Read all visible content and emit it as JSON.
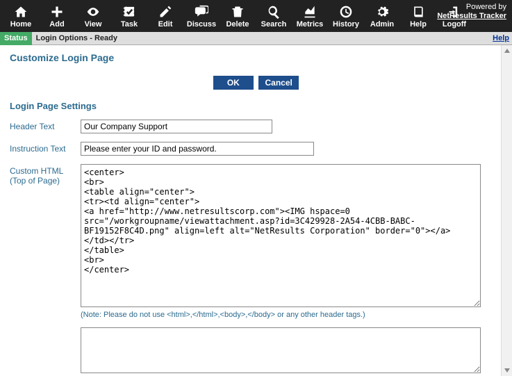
{
  "toolbar": {
    "items": [
      {
        "label": "Home",
        "icon": "home"
      },
      {
        "label": "Add",
        "icon": "plus"
      },
      {
        "label": "View",
        "icon": "eye"
      },
      {
        "label": "Task",
        "icon": "check"
      },
      {
        "label": "Edit",
        "icon": "pencil"
      },
      {
        "label": "Discuss",
        "icon": "chat"
      },
      {
        "label": "Delete",
        "icon": "trash"
      },
      {
        "label": "Search",
        "icon": "search"
      },
      {
        "label": "Metrics",
        "icon": "chart"
      },
      {
        "label": "History",
        "icon": "clock"
      },
      {
        "label": "Admin",
        "icon": "gear"
      },
      {
        "label": "Help",
        "icon": "book"
      },
      {
        "label": "Logoff",
        "icon": "logout"
      }
    ],
    "powered_by": "Powered by",
    "powered_link": "NetResults Tracker"
  },
  "statusbar": {
    "label": "Status",
    "text": "Login Options - Ready",
    "help": "Help"
  },
  "page": {
    "title": "Customize Login Page",
    "ok": "OK",
    "cancel": "Cancel",
    "section": "Login Page Settings",
    "header_text_label": "Header Text",
    "header_text_value": "Our Company Support",
    "instruction_label": "Instruction Text",
    "instruction_value": "Please enter your ID and password.",
    "custom_html_label_1": "Custom HTML",
    "custom_html_label_2": "(Top of Page)",
    "custom_html_value": "<center>\n<br>\n<table align=\"center\">\n<tr><td align=\"center\">\n<a href=\"http://www.netresultscorp.com\"><IMG hspace=0 src=\"/workgroupname/viewattachment.asp?id=3C429928-2A54-4CBB-BABC-BF19152F8C4D.png\" align=left alt=\"NetResults Corporation\" border=\"0\"></a>\n</td></tr>\n</table>\n<br>\n</center>",
    "note": "(Note: Please do not use <html>,</html>,<body>,</body> or any other header tags.)"
  }
}
